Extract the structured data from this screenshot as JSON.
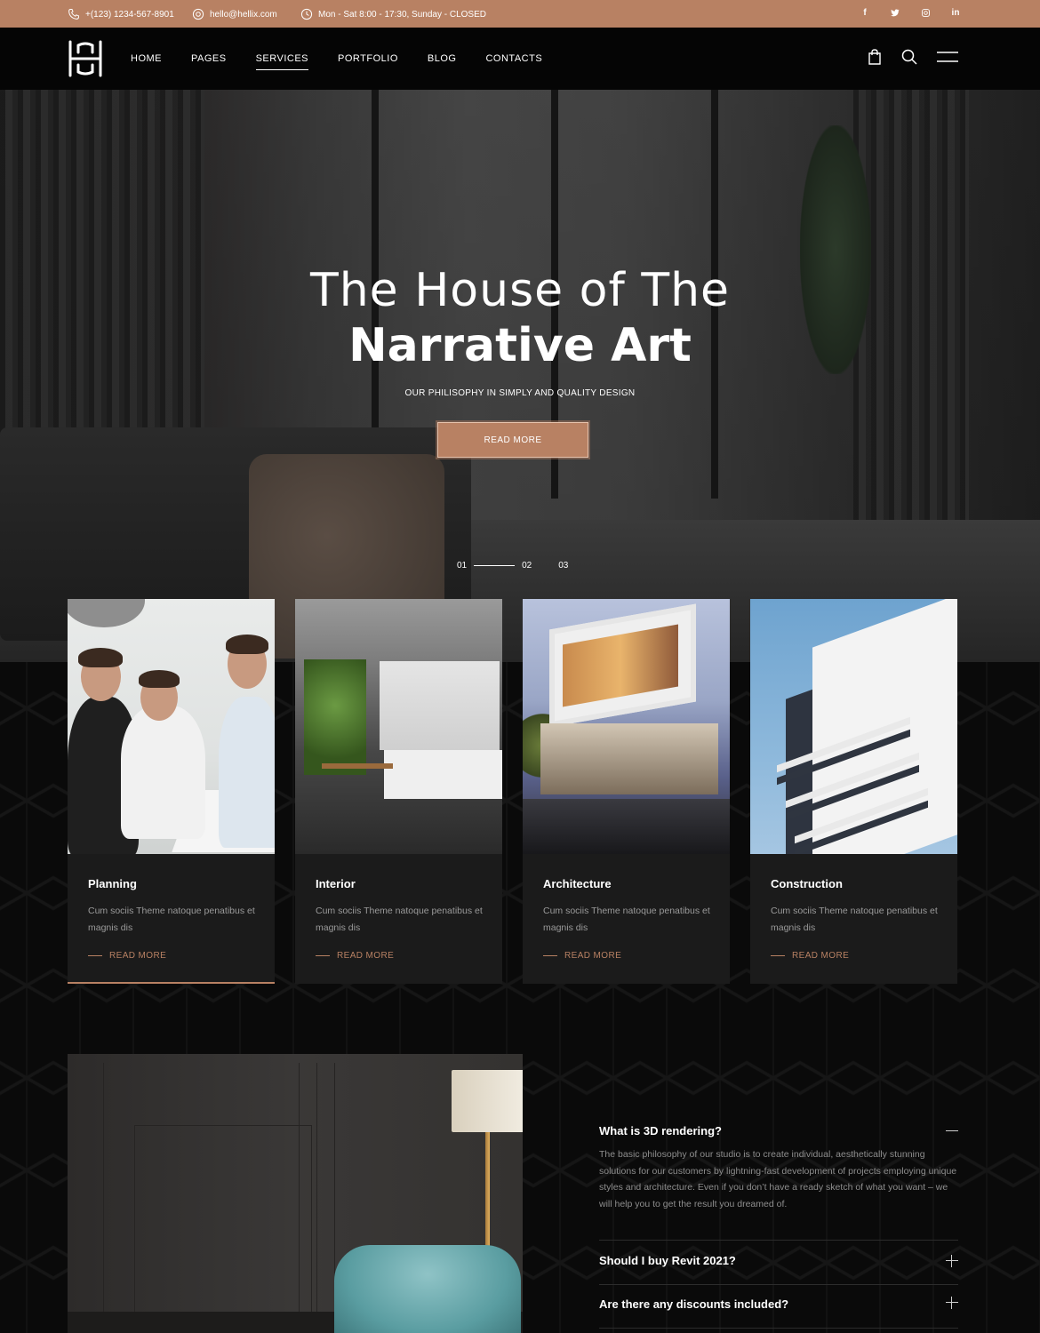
{
  "colors": {
    "accent": "#b88163",
    "background": "#0a0a0a",
    "card": "#1b1b1b"
  },
  "topbar": {
    "phone": "+(123) 1234-567-8901",
    "email": "hello@hellix.com",
    "hours": "Mon - Sat 8:00 - 17:30, Sunday - CLOSED",
    "social": [
      "f",
      "t",
      "ig",
      "in"
    ]
  },
  "nav": {
    "items": [
      "HOME",
      "PAGES",
      "SERVICES",
      "PORTFOLIO",
      "BLOG",
      "CONTACTS"
    ],
    "active": "SERVICES",
    "icons": [
      "shopping-bag-icon",
      "search-icon",
      "menu-icon"
    ]
  },
  "hero": {
    "title_line1": "The House of The",
    "title_line2": "Narrative Art",
    "subtitle": "OUR PHILISOPHY IN SIMPLY AND QUALITY DESIGN",
    "button": "READ MORE",
    "slides": [
      "01",
      "02",
      "03"
    ]
  },
  "services": [
    {
      "title": "Planning",
      "desc": "Cum sociis Theme natoque penatibus et magnis dis",
      "link": "READ MORE"
    },
    {
      "title": "Interior",
      "desc": "Cum sociis Theme natoque penatibus et magnis dis",
      "link": "READ MORE"
    },
    {
      "title": "Architecture",
      "desc": "Cum sociis Theme natoque penatibus et magnis dis",
      "link": "READ MORE"
    },
    {
      "title": "Construction",
      "desc": "Cum sociis Theme natoque penatibus et magnis dis",
      "link": "READ MORE"
    }
  ],
  "faq": [
    {
      "q": "What is 3D rendering?",
      "open": true,
      "a": "The basic philosophy of our studio is to create individual, aesthetically stunning solutions for our customers by lightning-fast development of projects employing unique styles and architecture. Even if you don’t have a ready sketch of what you want – we will help you to get the result you dreamed of."
    },
    {
      "q": "Should I buy Revit 2021?",
      "open": false
    },
    {
      "q": "Are there any discounts included?",
      "open": false
    }
  ]
}
